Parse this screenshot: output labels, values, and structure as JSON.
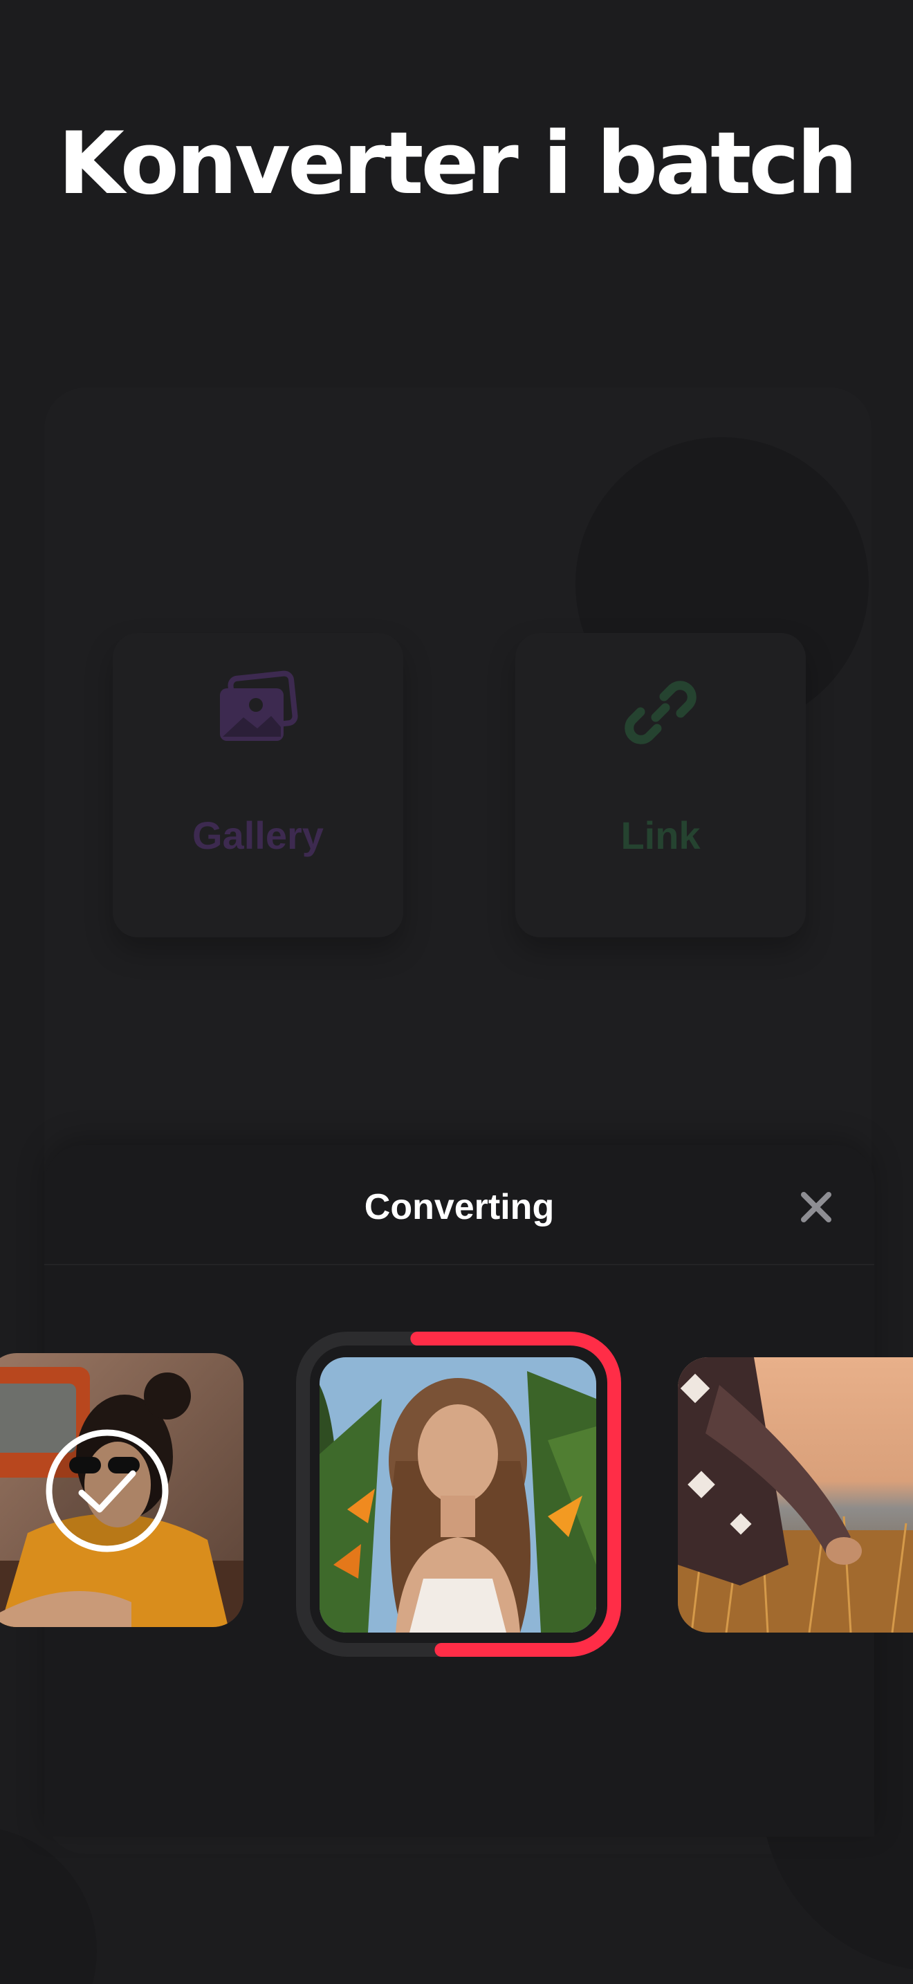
{
  "headline": "Konverter i batch",
  "background": {
    "cards": [
      {
        "label": "Gallery",
        "icon": "photos-icon",
        "color": "#3d2a50"
      },
      {
        "label": "Link",
        "icon": "link-icon",
        "color": "#254330"
      }
    ]
  },
  "sheet": {
    "title": "Converting",
    "close_icon": "close-icon",
    "accent_color": "#ff2d47"
  },
  "conversion": {
    "items": [
      {
        "status": "done"
      },
      {
        "status": "converting",
        "progress": 0.55
      },
      {
        "status": "pending"
      }
    ]
  }
}
